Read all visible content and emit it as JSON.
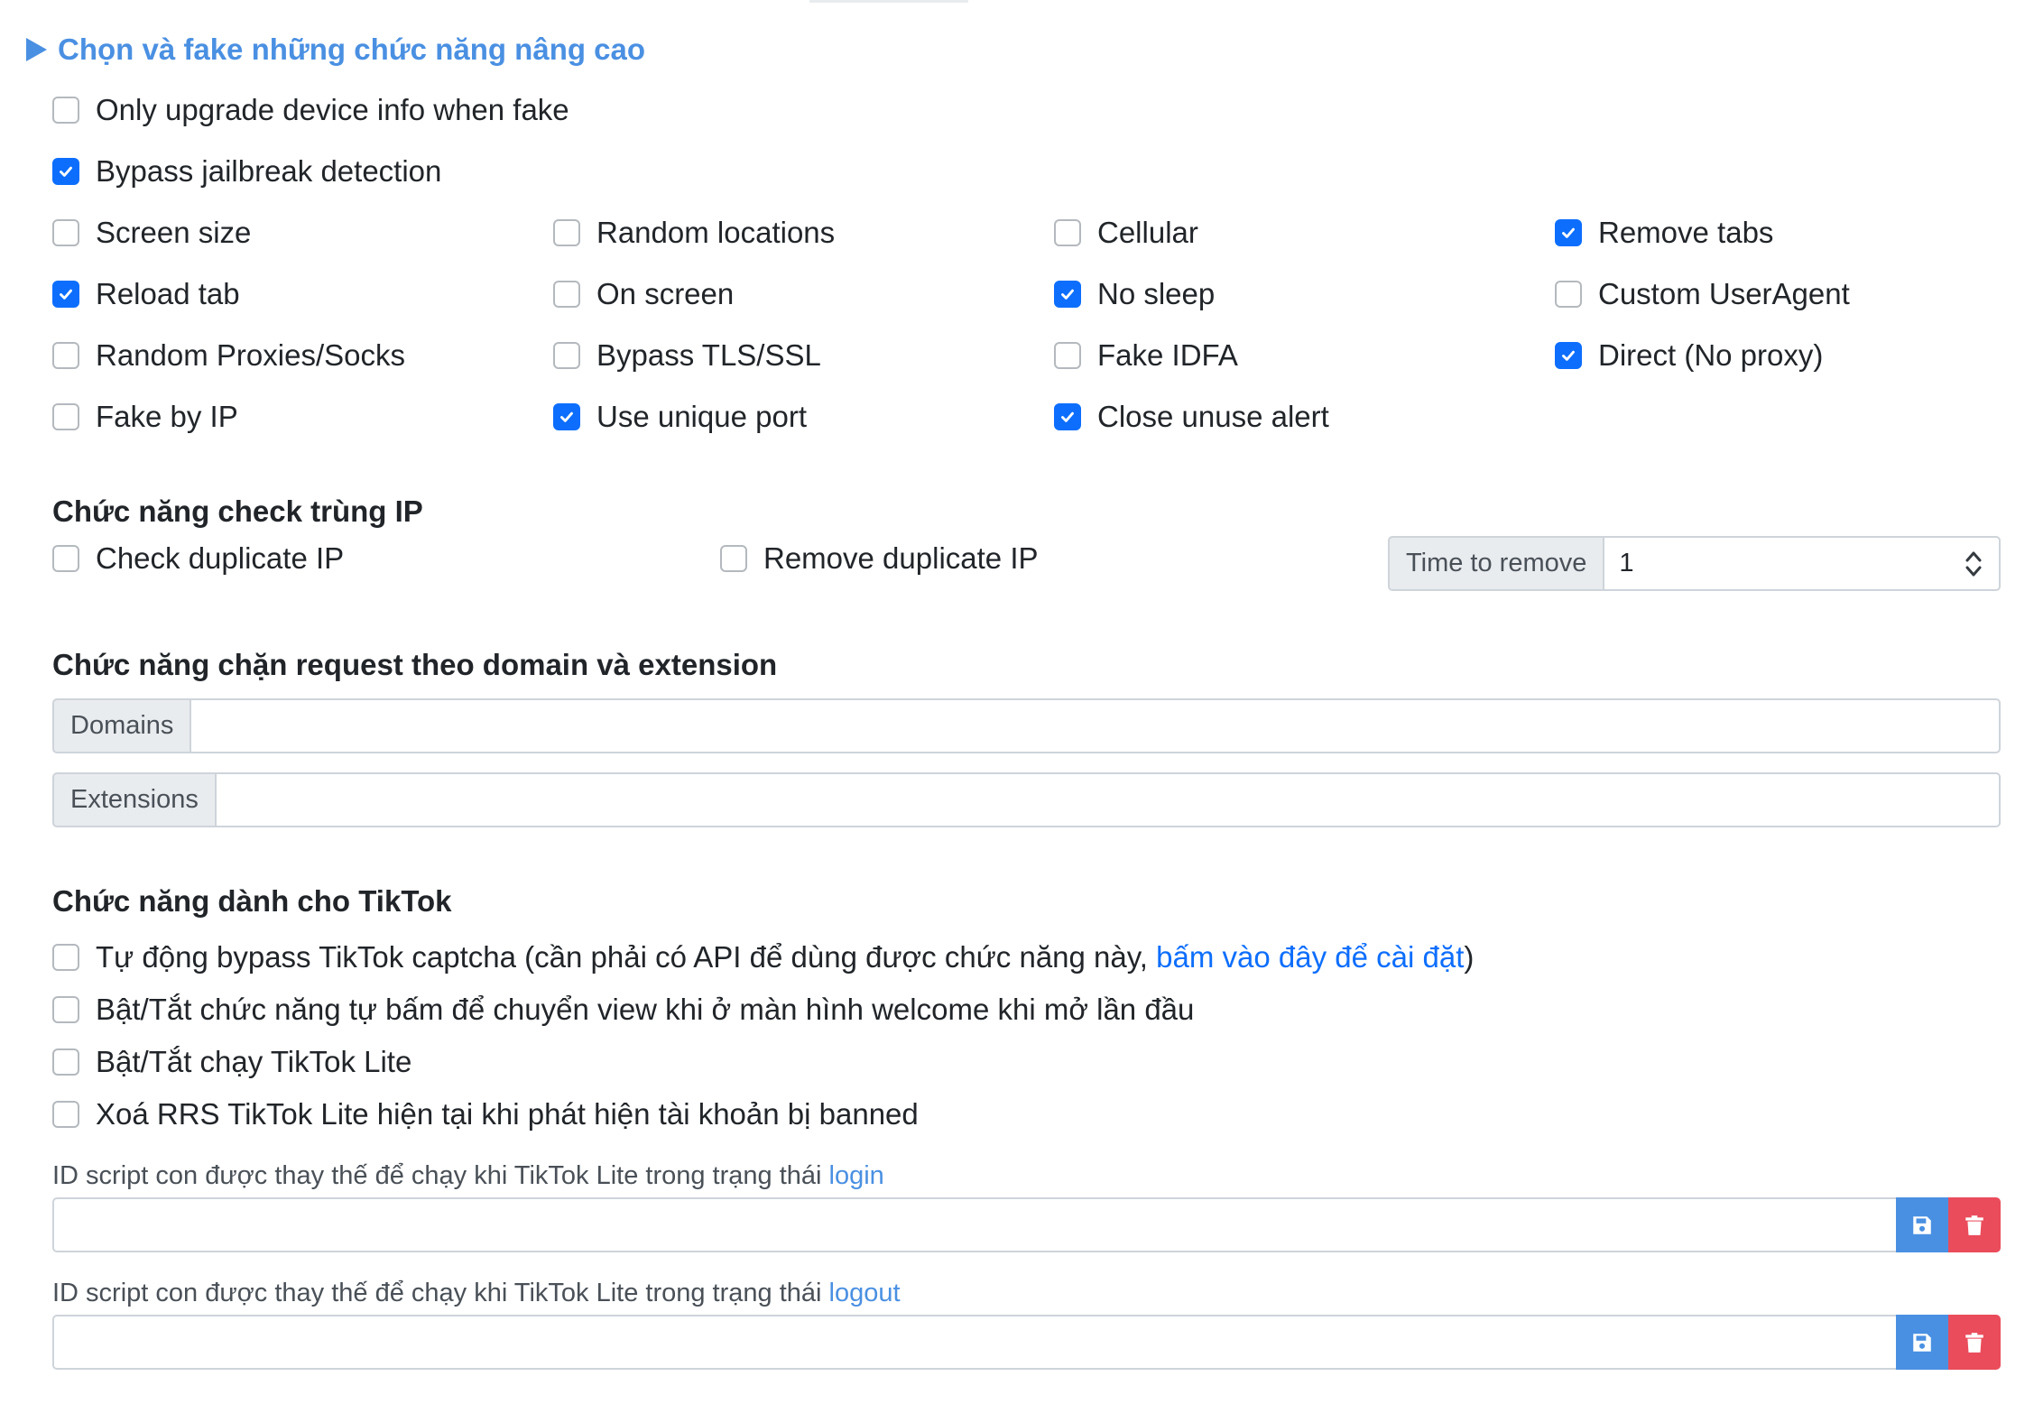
{
  "section": {
    "title": "Chọn và fake những chức năng nâng cao"
  },
  "options": {
    "only_upgrade": {
      "label": "Only upgrade device info when fake",
      "checked": false
    },
    "bypass_jailbreak": {
      "label": "Bypass jailbreak detection",
      "checked": true
    },
    "grid": [
      {
        "label": "Screen size",
        "checked": false
      },
      {
        "label": "Random locations",
        "checked": false
      },
      {
        "label": "Cellular",
        "checked": false
      },
      {
        "label": "Remove tabs",
        "checked": true
      },
      {
        "label": "Reload tab",
        "checked": true
      },
      {
        "label": "On screen",
        "checked": false
      },
      {
        "label": "No sleep",
        "checked": true
      },
      {
        "label": "Custom UserAgent",
        "checked": false
      },
      {
        "label": "Random Proxies/Socks",
        "checked": false
      },
      {
        "label": "Bypass TLS/SSL",
        "checked": false
      },
      {
        "label": "Fake IDFA",
        "checked": false
      },
      {
        "label": "Direct (No proxy)",
        "checked": true
      },
      {
        "label": "Fake by IP",
        "checked": false
      },
      {
        "label": "Use unique port",
        "checked": true
      },
      {
        "label": "Close unuse alert",
        "checked": true
      }
    ]
  },
  "duplicate_ip": {
    "heading": "Chức năng check trùng IP",
    "check_label": "Check duplicate IP",
    "check_checked": false,
    "remove_label": "Remove duplicate IP",
    "remove_checked": false,
    "time_label": "Time to remove",
    "time_value": "1"
  },
  "block_request": {
    "heading": "Chức năng chặn request theo domain và extension",
    "domains_label": "Domains",
    "domains_value": "",
    "extensions_label": "Extensions",
    "extensions_value": ""
  },
  "tiktok": {
    "heading": "Chức năng dành cho TikTok",
    "captcha_prefix": "Tự động bypass TikTok captcha (cần phải có API để dùng được chức năng này, ",
    "captcha_link": "bấm vào đây để cài đặt",
    "captcha_suffix": ")",
    "captcha_checked": false,
    "welcome_label": "Bật/Tắt chức năng tự bấm để chuyển view khi ở màn hình welcome khi mở lần đầu",
    "welcome_checked": false,
    "lite_label": "Bật/Tắt chạy TikTok Lite",
    "lite_checked": false,
    "delete_rrs_label": "Xoá RRS TikTok Lite hiện tại khi phát hiện tài khoản bị banned",
    "delete_rrs_checked": false,
    "login_prefix": "ID script con được thay thế để chạy khi TikTok Lite trong trạng thái ",
    "login_word": "login",
    "login_value": "",
    "logout_prefix": "ID script con được thay thế để chạy khi TikTok Lite trong trạng thái ",
    "logout_word": "logout",
    "logout_value": ""
  },
  "icons": {
    "checkmark": "check-icon",
    "save": "floppy-disk-icon",
    "delete": "trash-icon",
    "spinner": "up-down-chevron-icon",
    "toggle": "triangle-right-icon"
  },
  "colors": {
    "primary": "#0d6efd",
    "accent_link": "#4a90e2",
    "danger": "#ea4c5b"
  }
}
